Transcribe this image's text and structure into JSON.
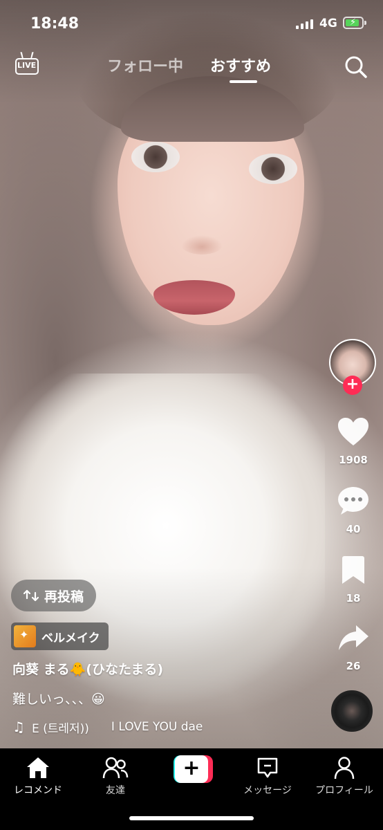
{
  "status_bar": {
    "time": "18:48",
    "network": "4G",
    "battery_level": 0.85,
    "battery_color": "#57d35a"
  },
  "top_nav": {
    "live_label": "LIVE",
    "tabs": [
      {
        "label": "フォロー中",
        "active": false
      },
      {
        "label": "おすすめ",
        "active": true
      }
    ],
    "search_icon": "search-icon"
  },
  "right_rail": {
    "likes": "1908",
    "comments": "40",
    "saves": "18",
    "shares": "26",
    "follow_plus": "+",
    "accent": "#fe2c55"
  },
  "post": {
    "repost_label": "再投稿",
    "effect_label": "ベルメイク",
    "username": "向葵 まる🐥(ひなたまる)",
    "caption": "難しいっ、、、😀",
    "music_left": "E (트레저))",
    "music_right": "I LOVE YOU dae"
  },
  "bottom_nav": {
    "items": [
      {
        "label": "レコメンド",
        "icon": "home-icon"
      },
      {
        "label": "友達",
        "icon": "friends-icon"
      },
      {
        "label": "+",
        "icon": "create-icon"
      },
      {
        "label": "メッセージ",
        "icon": "inbox-icon"
      },
      {
        "label": "プロフィール",
        "icon": "profile-icon"
      }
    ],
    "create_colors": {
      "left": "#25f4ee",
      "right": "#fe2c55"
    }
  }
}
